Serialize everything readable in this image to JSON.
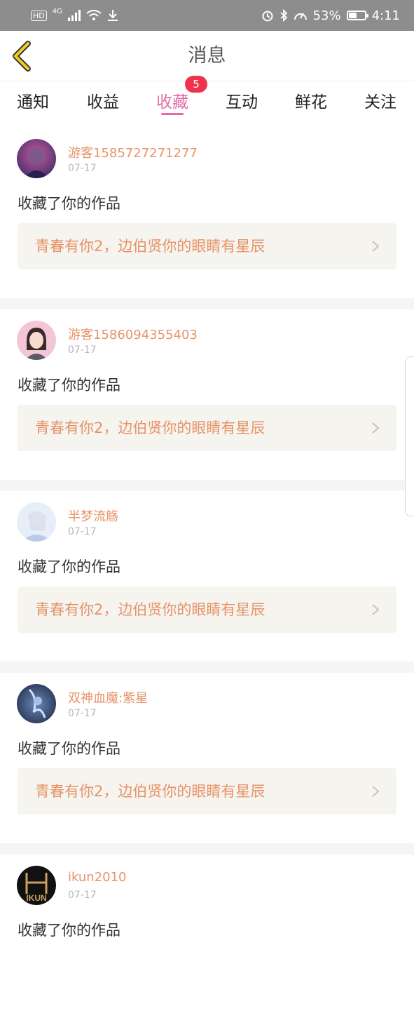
{
  "status_bar": {
    "hd": "HD",
    "network": "4G",
    "battery_percent": "53%",
    "battery_level": 0.53,
    "time": "4:11",
    "icons": [
      "signal-icon",
      "wifi-icon",
      "download-icon",
      "alarm-icon",
      "bluetooth-icon",
      "speed-icon",
      "battery-icon"
    ]
  },
  "header": {
    "title": "消息",
    "back_icon": "chevron-left-icon"
  },
  "tabs": [
    {
      "label": "通知"
    },
    {
      "label": "收益"
    },
    {
      "label": "收藏",
      "active": true
    },
    {
      "label": "互动"
    },
    {
      "label": "鲜花"
    },
    {
      "label": "关注"
    }
  ],
  "tab_badge": "5",
  "colors": {
    "accent": "#e56aa6",
    "username": "#e79368",
    "badge": "#f0334d",
    "status_bar": "#8d8d8d"
  },
  "items": [
    {
      "username": "游客1585727271277",
      "date": "07-17",
      "action": "收藏了你的作品",
      "work_title": "青春有你2，边伯贤你的眼睛有星辰"
    },
    {
      "username": "游客1586094355403",
      "date": "07-17",
      "action": "收藏了你的作品",
      "work_title": "青春有你2，边伯贤你的眼睛有星辰"
    },
    {
      "username": "半梦流觞",
      "date": "07-17",
      "action": "收藏了你的作品",
      "work_title": "青春有你2，边伯贤你的眼睛有星辰"
    },
    {
      "username": "双神血魔:紫星",
      "date": "07-17",
      "action": "收藏了你的作品",
      "work_title": "青春有你2，边伯贤你的眼睛有星辰"
    },
    {
      "username": "ikun2010",
      "date": "07-17",
      "action": "收藏了你的作品",
      "avatar_text": "IKUN"
    }
  ]
}
